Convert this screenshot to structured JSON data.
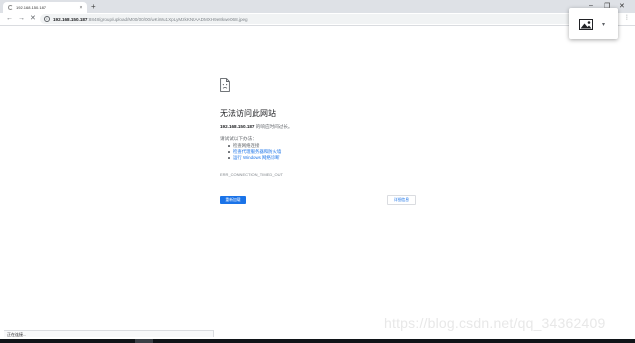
{
  "browser": {
    "tab": {
      "title": "192.168.150.187",
      "close": "×"
    },
    "new_tab": "+",
    "window_controls": {
      "minimize": "–",
      "maximize": "❐",
      "close": "✕"
    },
    "nav": {
      "back": "←",
      "forward": "→",
      "stop": "✕"
    },
    "address": {
      "host": "192.168.150.187",
      "path": ":8848/group/upload/M00/00/00/wKiWu1XpLyMzkKNtAADMXH9e8kwe068.jpeg"
    },
    "menu": "⋮"
  },
  "popup": {
    "chevron": "▾"
  },
  "error": {
    "title": "无法访问此网站",
    "host": "192.168.150.187",
    "host_suffix": " 的响应时间过长。",
    "try_label": "请试试以下办法：",
    "suggestions": [
      "检查网络连接",
      "检查代理服务器和防火墙",
      "运行 Windows 网络诊断"
    ],
    "code": "ERR_CONNECTION_TIMED_OUT",
    "reload_button": "重新加载",
    "details_button": "详细信息"
  },
  "status_bar": "正在连接...",
  "watermark": "https://blog.csdn.net/qq_34362409",
  "colors": {
    "primary": "#1a73e8",
    "tabstrip": "#dee1e6"
  }
}
